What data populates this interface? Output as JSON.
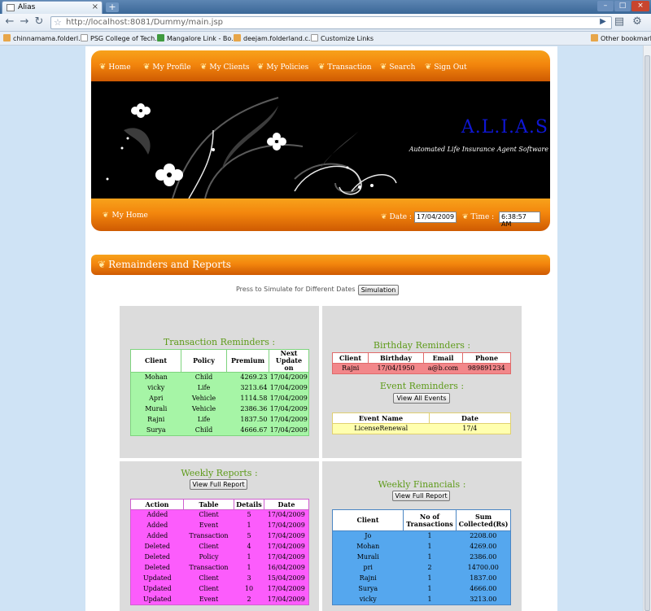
{
  "browser": {
    "tab_title": "Alias",
    "url": "http://localhost:8081/Dummy/main.jsp",
    "bookmarks": [
      "chinnamama.folderl...",
      "PSG College of Tech...",
      "Mangalore Link - Bo...",
      "deejam.folderland.c...",
      "Customize Links"
    ],
    "other_bookmarks": "Other bookmarks"
  },
  "colors": {
    "orange": "#f3860d",
    "green_title": "#5e9b1a",
    "banner_title": "#0f17d4"
  },
  "site": {
    "nav": [
      "Home",
      "My Profile",
      "My Clients",
      "My Policies",
      "Transaction",
      "Search",
      "Sign Out"
    ],
    "title": "A.L.I.A.S",
    "subtitle": "Automated Life Insurance Agent Software",
    "my_home": "My Home",
    "date_label": "Date :",
    "date_value": "17/04/2009",
    "time_label": "Time :",
    "time_value": "6:38:57 AM"
  },
  "section": {
    "title": "Remainders and Reports",
    "simulate_text": "Press to Simulate for Different Dates :",
    "simulate_button": "Simulation"
  },
  "transaction_reminders": {
    "title": "Transaction Reminders :",
    "headers": [
      "Client",
      "Policy",
      "Premium",
      "Next Update on"
    ],
    "rows": [
      [
        "Mohan",
        "Child",
        "4269.23",
        "17/04/2009"
      ],
      [
        "vicky",
        "Life",
        "3213.64",
        "17/04/2009"
      ],
      [
        "Apri",
        "Vehicle",
        "1114.58",
        "17/04/2009"
      ],
      [
        "Murali",
        "Vehicle",
        "2386.36",
        "17/04/2009"
      ],
      [
        "Rajni",
        "Life",
        "1837.50",
        "17/04/2009"
      ],
      [
        "Surya",
        "Child",
        "4666.67",
        "17/04/2009"
      ]
    ]
  },
  "birthday_reminders": {
    "title": "Birthday Reminders :",
    "headers": [
      "Client",
      "Birthday",
      "Email",
      "Phone"
    ],
    "rows": [
      [
        "Rajni",
        "17/04/1950",
        "a@b.com",
        "989891234"
      ]
    ]
  },
  "event_reminders": {
    "title": "Event Reminders :",
    "button": "View All Events",
    "headers": [
      "Event Name",
      "Date"
    ],
    "rows": [
      [
        "LicenseRenewal",
        "17/4"
      ]
    ]
  },
  "weekly_reports": {
    "title": "Weekly Reports :",
    "button": "View Full Report",
    "headers": [
      "Action",
      "Table",
      "Details",
      "Date"
    ],
    "rows": [
      [
        "Added",
        "Client",
        "5",
        "17/04/2009"
      ],
      [
        "Added",
        "Event",
        "1",
        "17/04/2009"
      ],
      [
        "Added",
        "Transaction",
        "5",
        "17/04/2009"
      ],
      [
        "Deleted",
        "Client",
        "4",
        "17/04/2009"
      ],
      [
        "Deleted",
        "Policy",
        "1",
        "17/04/2009"
      ],
      [
        "Deleted",
        "Transaction",
        "1",
        "16/04/2009"
      ],
      [
        "Updated",
        "Client",
        "3",
        "15/04/2009"
      ],
      [
        "Updated",
        "Client",
        "10",
        "17/04/2009"
      ],
      [
        "Updated",
        "Event",
        "2",
        "17/04/2009"
      ]
    ]
  },
  "weekly_financials": {
    "title": "Weekly Financials :",
    "button": "View Full Report",
    "headers": [
      "Client",
      "No of Transactions",
      "Sum Collected(Rs)"
    ],
    "rows": [
      [
        "Jo",
        "1",
        "2208.00"
      ],
      [
        "Mohan",
        "1",
        "4269.00"
      ],
      [
        "Murali",
        "1",
        "2386.00"
      ],
      [
        "pri",
        "2",
        "14700.00"
      ],
      [
        "Rajni",
        "1",
        "1837.00"
      ],
      [
        "Surya",
        "1",
        "4666.00"
      ],
      [
        "vicky",
        "1",
        "3213.00"
      ]
    ]
  }
}
